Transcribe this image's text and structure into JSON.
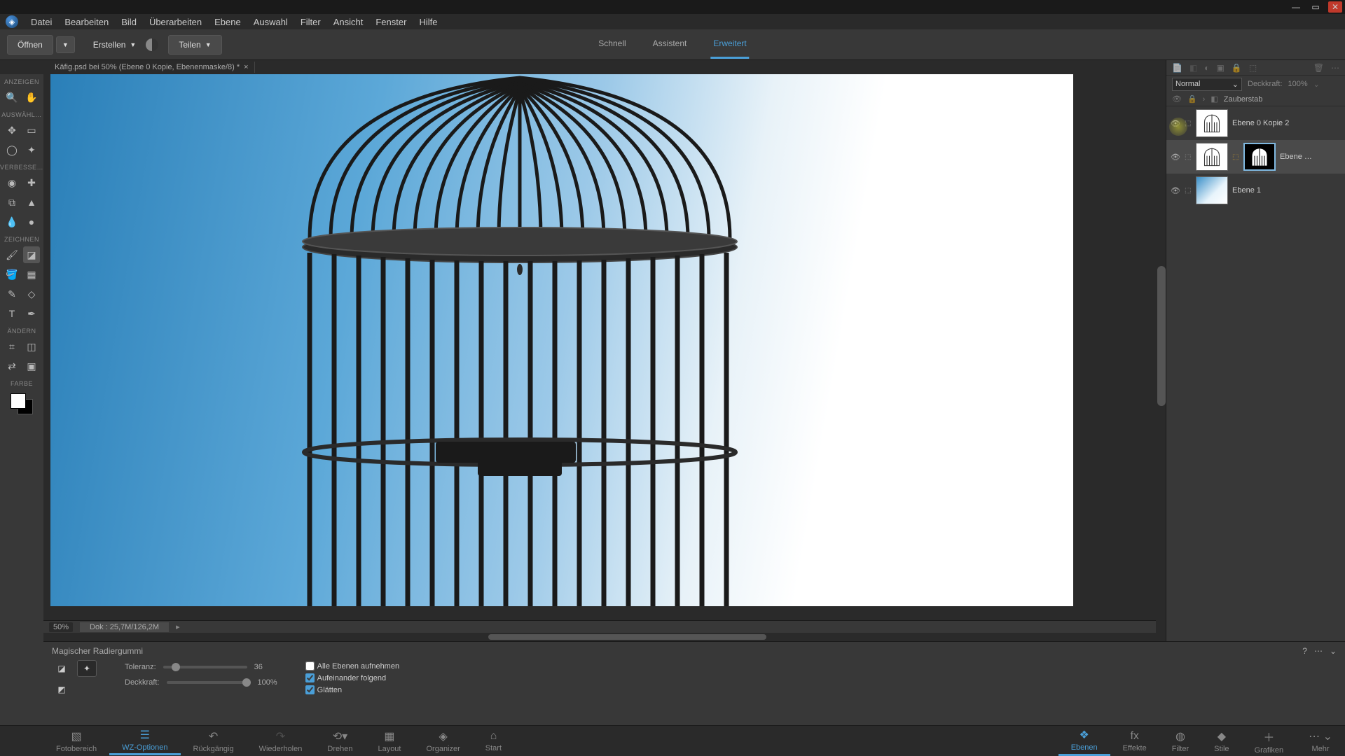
{
  "menu": [
    "Datei",
    "Bearbeiten",
    "Bild",
    "Überarbeiten",
    "Ebene",
    "Auswahl",
    "Filter",
    "Ansicht",
    "Fenster",
    "Hilfe"
  ],
  "actionbar": {
    "open": "Öffnen",
    "create": "Erstellen",
    "share": "Teilen"
  },
  "modes": {
    "quick": "Schnell",
    "guided": "Assistent",
    "expert": "Erweitert"
  },
  "doctab": {
    "title": "Käfig.psd bei 50% (Ebene 0 Kopie, Ebenenmaske/8) *",
    "close": "×"
  },
  "toolbox": {
    "show": "ANZEIGEN",
    "select": "AUSWÄHL…",
    "enhance": "VERBESSE…",
    "draw": "ZEICHNEN",
    "modify": "ÄNDERN",
    "color": "FARBE"
  },
  "docfooter": {
    "zoom": "50%",
    "docsize": "Dok : 25,7M/126,2M"
  },
  "layers": {
    "blendmode": "Normal",
    "opacity_label": "Deckkraft:",
    "opacity_value": "100%",
    "filter_label": "Zauberstab",
    "items": [
      {
        "name": "Ebene 0 Kopie 2",
        "visible": true
      },
      {
        "name": "Ebene …",
        "visible": true,
        "selected": true,
        "has_mask": true
      },
      {
        "name": "Ebene 1",
        "visible": true
      }
    ]
  },
  "options": {
    "title": "Magischer Radiergummi",
    "tolerance_label": "Toleranz:",
    "tolerance_value": "36",
    "opacity_label": "Deckkraft:",
    "opacity_value": "100%",
    "cb_all_layers": "Alle Ebenen aufnehmen",
    "cb_contiguous": "Aufeinander folgend",
    "cb_antialias": "Glätten"
  },
  "bottombar": {
    "left": [
      {
        "id": "photobin",
        "label": "Fotobereich"
      },
      {
        "id": "tooloptions",
        "label": "WZ-Optionen",
        "active": true
      },
      {
        "id": "undo",
        "label": "Rückgängig"
      },
      {
        "id": "redo",
        "label": "Wiederholen"
      },
      {
        "id": "rotate",
        "label": "Drehen"
      },
      {
        "id": "layout",
        "label": "Layout"
      },
      {
        "id": "organizer",
        "label": "Organizer"
      },
      {
        "id": "home",
        "label": "Start"
      }
    ],
    "right": [
      {
        "id": "layers",
        "label": "Ebenen",
        "active": true
      },
      {
        "id": "effects",
        "label": "Effekte"
      },
      {
        "id": "filters",
        "label": "Filter"
      },
      {
        "id": "styles",
        "label": "Stile"
      },
      {
        "id": "graphics",
        "label": "Grafiken"
      },
      {
        "id": "more",
        "label": "Mehr"
      }
    ]
  }
}
